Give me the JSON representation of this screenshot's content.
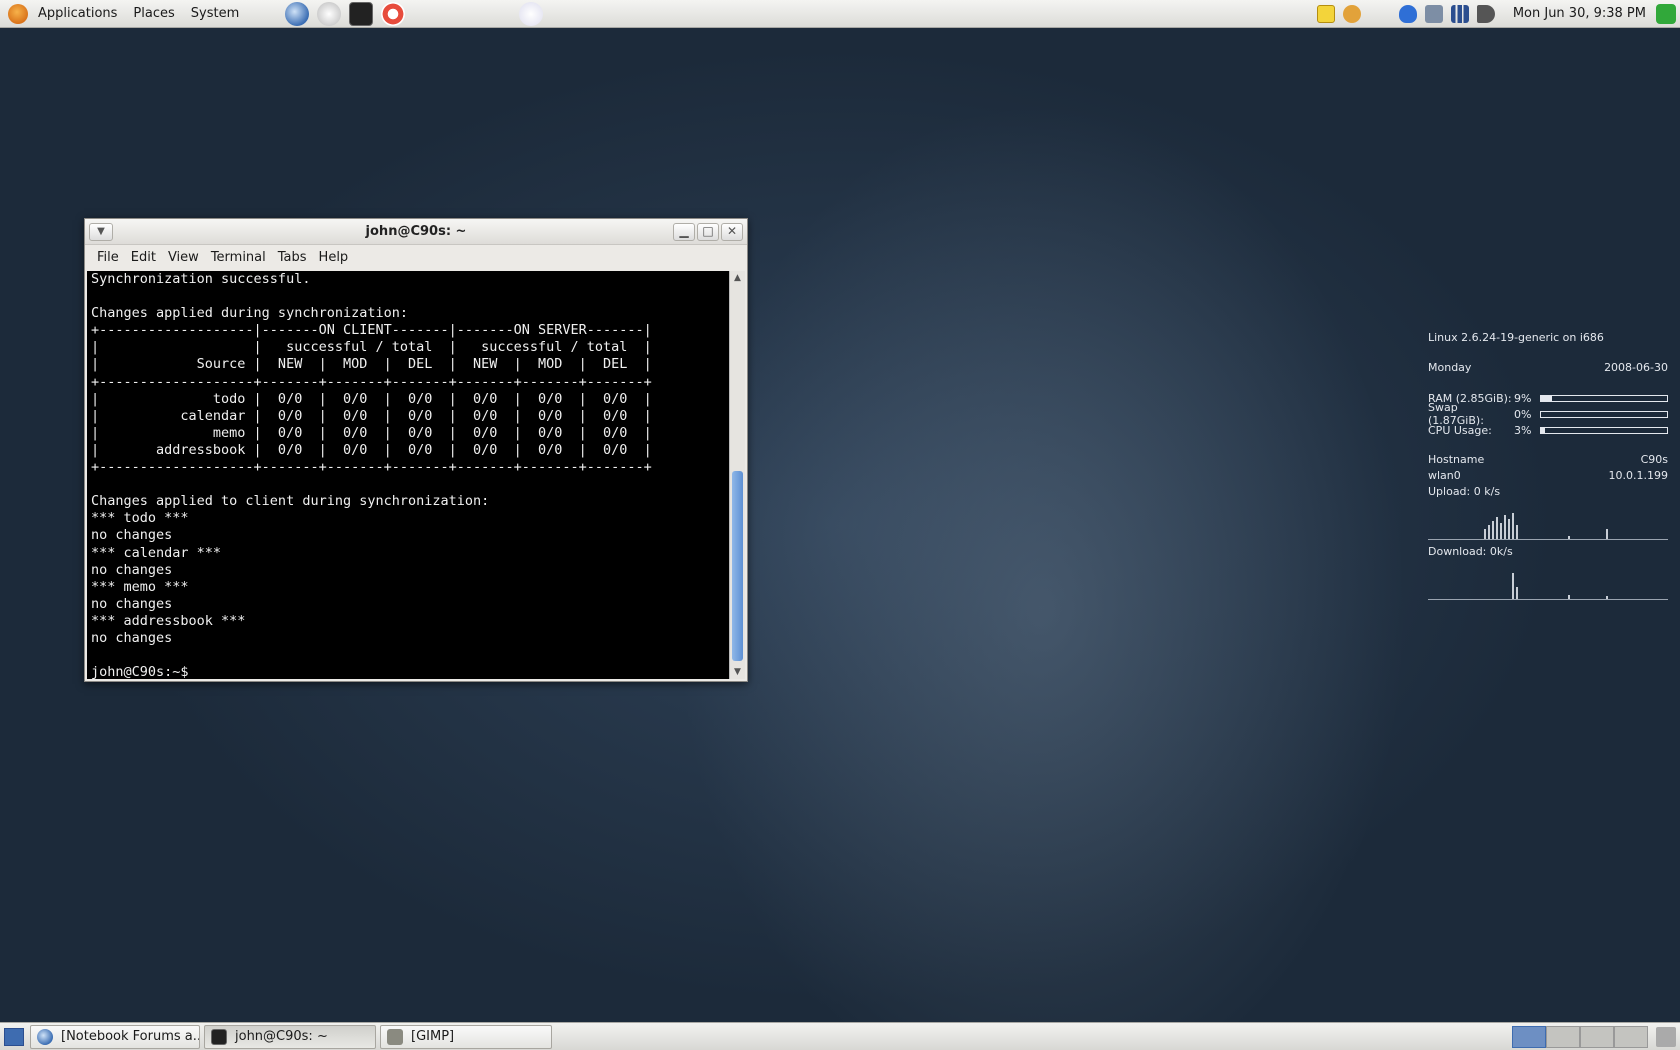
{
  "top_panel": {
    "menus": [
      "Applications",
      "Places",
      "System"
    ],
    "clock": "Mon Jun 30,  9:38 PM"
  },
  "conky": {
    "system": "Linux 2.6.24-19-generic on i686",
    "day": "Monday",
    "date": "2008-06-30",
    "ram_label": "RAM (2.85GiB):",
    "ram_pct": "9%",
    "ram_fraction": 0.09,
    "swap_label": "Swap (1.87GiB):",
    "swap_pct": "0%",
    "swap_fraction": 0.0,
    "cpu_label": "CPU Usage:",
    "cpu_pct": "3%",
    "cpu_fraction": 0.03,
    "hostname_label": "Hostname",
    "hostname": "C90s",
    "iface": "wlan0",
    "ip": "10.0.1.199",
    "upload": "Upload:   0 k/s",
    "download": "Download: 0k/s"
  },
  "terminal": {
    "title": "john@C90s: ~",
    "menu": [
      "File",
      "Edit",
      "View",
      "Terminal",
      "Tabs",
      "Help"
    ],
    "lines": [
      "Synchronization successful.",
      "",
      "Changes applied during synchronization:",
      "+-------------------|-------ON CLIENT-------|-------ON SERVER-------|",
      "|                   |   successful / total  |   successful / total  |",
      "|            Source |  NEW  |  MOD  |  DEL  |  NEW  |  MOD  |  DEL  |",
      "+-------------------+-------+-------+-------+-------+-------+-------+",
      "|              todo |  0/0  |  0/0  |  0/0  |  0/0  |  0/0  |  0/0  |",
      "|          calendar |  0/0  |  0/0  |  0/0  |  0/0  |  0/0  |  0/0  |",
      "|              memo |  0/0  |  0/0  |  0/0  |  0/0  |  0/0  |  0/0  |",
      "|       addressbook |  0/0  |  0/0  |  0/0  |  0/0  |  0/0  |  0/0  |",
      "+-------------------+-------+-------+-------+-------+-------+-------+",
      "",
      "Changes applied to client during synchronization:",
      "*** todo ***",
      "no changes",
      "*** calendar ***",
      "no changes",
      "*** memo ***",
      "no changes",
      "*** addressbook ***",
      "no changes",
      "",
      "john@C90s:~$ "
    ]
  },
  "taskbar": {
    "tasks": [
      "[Notebook Forums a...",
      "john@C90s: ~",
      "[GIMP]"
    ]
  }
}
